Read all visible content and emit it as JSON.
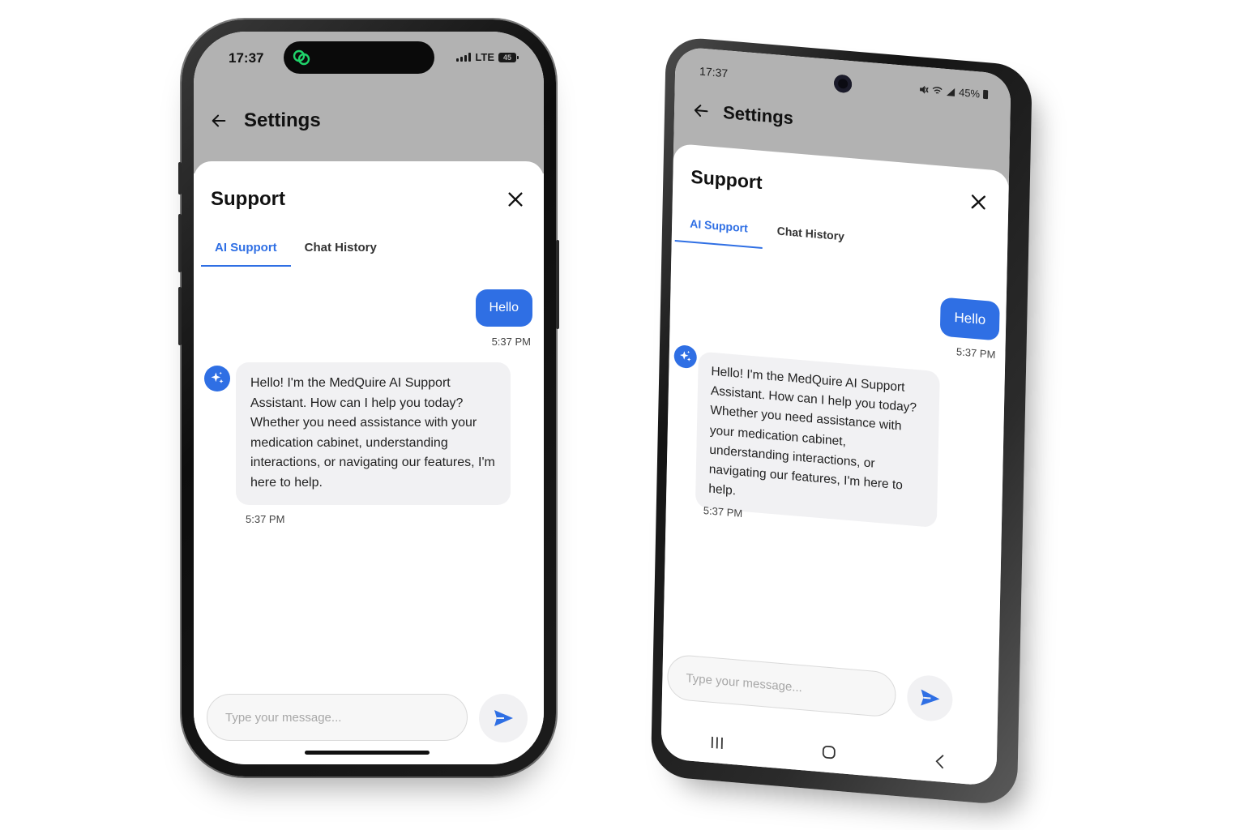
{
  "phones": [
    {
      "status": {
        "time": "17:37",
        "network": "LTE",
        "battery": "45"
      },
      "appbar": {
        "title": "Settings"
      },
      "sheet": {
        "title": "Support",
        "tabs": [
          {
            "label": "AI Support",
            "active": true
          },
          {
            "label": "Chat History",
            "active": false
          }
        ],
        "messages": [
          {
            "role": "user",
            "text": "Hello",
            "time": "5:37 PM"
          },
          {
            "role": "assistant",
            "text": "Hello! I'm the MedQuire AI Support Assistant. How can I help you today? Whether you need assistance with your medication cabinet, understanding interactions, or navigating our features, I'm here to help.",
            "time": "5:37 PM"
          }
        ],
        "composer": {
          "placeholder": "Type your message..."
        }
      }
    },
    {
      "status": {
        "time": "17:37",
        "battery": "45%"
      },
      "appbar": {
        "title": "Settings"
      },
      "sheet": {
        "title": "Support",
        "tabs": [
          {
            "label": "AI Support",
            "active": true
          },
          {
            "label": "Chat History",
            "active": false
          }
        ],
        "messages": [
          {
            "role": "user",
            "text": "Hello",
            "time": "5:37 PM"
          },
          {
            "role": "assistant",
            "text": "Hello! I'm the MedQuire AI Support Assistant. How can I help you today? Whether you need assistance with your medication cabinet, understanding interactions, or navigating our features, I'm here to help.",
            "time": "5:37 PM"
          }
        ],
        "composer": {
          "placeholder": "Type your message..."
        }
      }
    }
  ],
  "colors": {
    "accent": "#2f6fe4",
    "header_gray": "#b2b2b2",
    "bubble_gray": "#f1f1f3",
    "island_icon": "#1fd36a"
  },
  "icons": [
    "back-arrow-icon",
    "close-icon",
    "sparkle-icon",
    "send-icon",
    "signal-icon",
    "battery-icon",
    "recents-icon",
    "home-icon",
    "back-chevron-icon"
  ]
}
